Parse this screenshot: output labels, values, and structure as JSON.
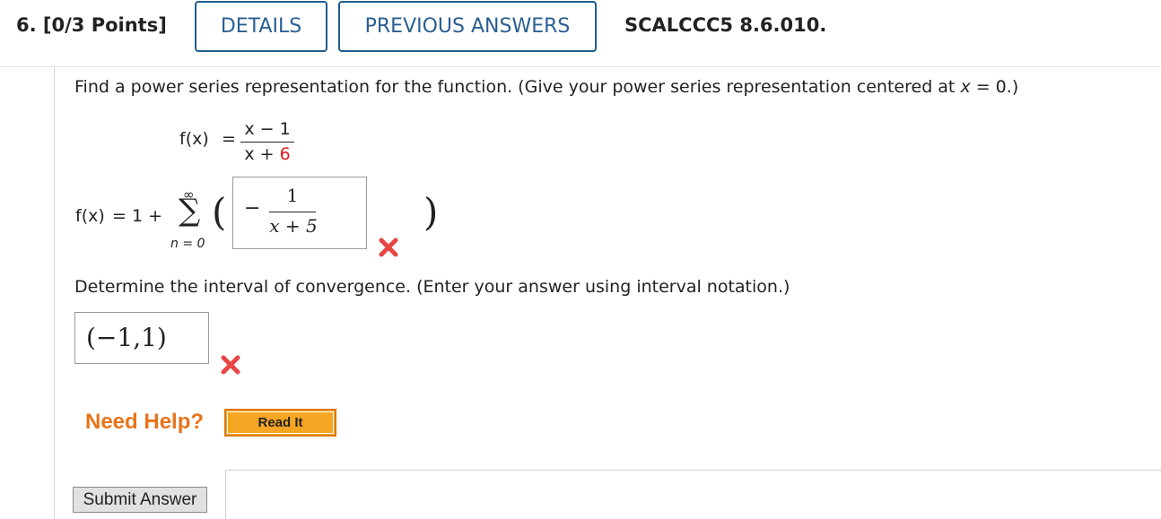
{
  "header": {
    "question_label": "6.  [0/3 Points]",
    "details_label": "DETAILS",
    "previous_answers_label": "PREVIOUS ANSWERS",
    "problem_code": "SCALCCC5 8.6.010."
  },
  "prompt1": {
    "text_before": "Find a power series representation for the function. (Give your power series representation centered at ",
    "var": "x",
    "text_after": " = 0.)"
  },
  "function": {
    "lhs": "f(x)",
    "eq": "=",
    "numerator": "x − 1",
    "denominator_left": "x + ",
    "denominator_red": "6"
  },
  "series": {
    "lhs": "f(x)",
    "eq": "= 1 +",
    "upper": "∞",
    "sigma": "∑",
    "lower": "n = 0",
    "left_paren": "(",
    "right_paren": ")",
    "answer_minus": "−",
    "answer_numerator": "1",
    "answer_denominator": "x + 5",
    "status": "incorrect"
  },
  "prompt2": {
    "text": "Determine the interval of convergence. (Enter your answer using interval notation.)"
  },
  "interval": {
    "answer": "(−1,1)",
    "status": "incorrect"
  },
  "help": {
    "need_help": "Need Help?",
    "read_it": "Read It"
  },
  "submit": {
    "label": "Submit Answer"
  },
  "colors": {
    "link_blue": "#2a5f93",
    "error_red": "#e01b1b",
    "help_orange": "#e8741a",
    "button_orange": "#f5a623"
  }
}
